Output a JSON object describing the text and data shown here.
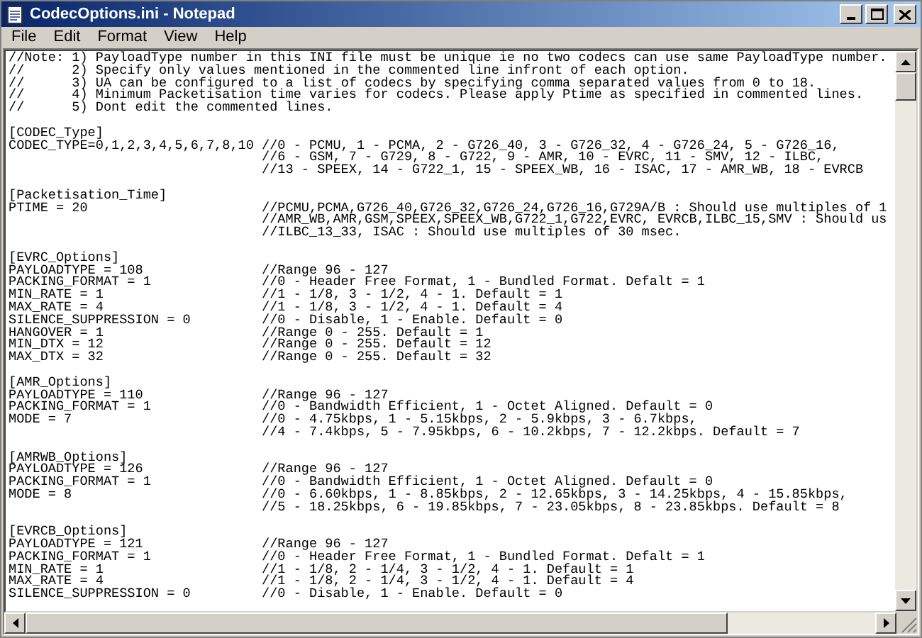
{
  "window": {
    "title": "CodecOptions.ini - Notepad"
  },
  "menu": [
    {
      "label": "File"
    },
    {
      "label": "Edit"
    },
    {
      "label": "Format"
    },
    {
      "label": "View"
    },
    {
      "label": "Help"
    }
  ],
  "blocks": [
    {
      "lines": [
        {
          "text": "//Note: 1) PayloadType number in this INI file must be unique ie no two codecs can use same PayloadType number."
        },
        {
          "text": "//      2) Specify only values mentioned in the commented line infront of each option."
        },
        {
          "text": "//      3) UA can be configured to a list of codecs by specifying comma separated values from 0 to 18."
        },
        {
          "text": "//      4) Minimum Packetisation time varies for codecs. Please apply Ptime as specified in commented lines."
        },
        {
          "text": "//      5) Dont edit the commented lines."
        }
      ]
    },
    {
      "lines": [
        {
          "text": "[CODEC_Type]"
        },
        {
          "setting": "CODEC_TYPE=0,1,2,3,4,5,6,7,8,10",
          "comment": "//0 - PCMU, 1 - PCMA, 2 - G726_40, 3 - G726_32, 4 - G726_24, 5 - G726_16,"
        },
        {
          "comment": "//6 - GSM, 7 - G729, 8 - G722, 9 - AMR, 10 - EVRC, 11 - SMV, 12 - ILBC,"
        },
        {
          "comment": "//13 - SPEEX, 14 - G722_1, 15 - SPEEX_WB, 16 - ISAC, 17 - AMR_WB, 18 - EVRCB"
        }
      ]
    },
    {
      "lines": [
        {
          "text": "[Packetisation_Time]"
        },
        {
          "setting": "PTIME = 20",
          "comment": "//PCMU,PCMA,G726_40,G726_32,G726_24,G726_16,G729A/B : Should use multiples of 1"
        },
        {
          "comment": "//AMR_WB,AMR,GSM,SPEEX,SPEEX_WB,G722_1,G722,EVRC, EVRCB,ILBC_15,SMV : Should us"
        },
        {
          "comment": "//ILBC_13_33, ISAC : Should use multiples of 30 msec."
        }
      ]
    },
    {
      "lines": [
        {
          "text": "[EVRC_Options]"
        },
        {
          "setting": "PAYLOADTYPE = 108",
          "comment": "//Range 96 - 127"
        },
        {
          "setting": "PACKING_FORMAT = 1",
          "comment": "//0 - Header Free Format, 1 - Bundled Format. Defalt = 1"
        },
        {
          "setting": "MIN_RATE = 1",
          "comment": "//1 - 1/8, 3 - 1/2, 4 - 1. Default = 1"
        },
        {
          "setting": "MAX_RATE = 4",
          "comment": "//1 - 1/8, 3 - 1/2, 4 - 1. Default = 4"
        },
        {
          "setting": "SILENCE_SUPPRESSION = 0",
          "comment": "//0 - Disable, 1 - Enable. Default = 0"
        },
        {
          "setting": "HANGOVER = 1",
          "comment": "//Range 0 - 255. Default = 1"
        },
        {
          "setting": "MIN_DTX = 12",
          "comment": "//Range 0 - 255. Default = 12"
        },
        {
          "setting": "MAX_DTX = 32",
          "comment": "//Range 0 - 255. Default = 32"
        }
      ]
    },
    {
      "lines": [
        {
          "text": "[AMR_Options]"
        },
        {
          "setting": "PAYLOADTYPE = 110",
          "comment": "//Range 96 - 127"
        },
        {
          "setting": "PACKING_FORMAT = 1",
          "comment": "//0 - Bandwidth Efficient, 1 - Octet Aligned. Default = 0"
        },
        {
          "setting": "MODE = 7",
          "comment": "//0 - 4.75kbps, 1 - 5.15kbps, 2 - 5.9kbps, 3 - 6.7kbps,"
        },
        {
          "comment": "//4 - 7.4kbps, 5 - 7.95kbps, 6 - 10.2kbps, 7 - 12.2kbps. Default = 7"
        }
      ]
    },
    {
      "lines": [
        {
          "text": "[AMRWB_Options]"
        },
        {
          "setting": "PAYLOADTYPE = 126",
          "comment": "//Range 96 - 127"
        },
        {
          "setting": "PACKING_FORMAT = 1",
          "comment": "//0 - Bandwidth Efficient, 1 - Octet Aligned. Default = 0"
        },
        {
          "setting": "MODE = 8",
          "comment": "//0 - 6.60kbps, 1 - 8.85kbps, 2 - 12.65kbps, 3 - 14.25kbps, 4 - 15.85kbps,"
        },
        {
          "comment": "//5 - 18.25kbps, 6 - 19.85kbps, 7 - 23.05kbps, 8 - 23.85kbps. Default = 8"
        }
      ]
    },
    {
      "lines": [
        {
          "text": "[EVRCB_Options]"
        },
        {
          "setting": "PAYLOADTYPE = 121",
          "comment": "//Range 96 - 127"
        },
        {
          "setting": "PACKING_FORMAT = 1",
          "comment": "//0 - Header Free Format, 1 - Bundled Format. Defalt = 1"
        },
        {
          "setting": "MIN_RATE = 1",
          "comment": "//1 - 1/8, 2 - 1/4, 3 - 1/2, 4 - 1. Default = 1"
        },
        {
          "setting": "MAX_RATE = 4",
          "comment": "//1 - 1/8, 2 - 1/4, 3 - 1/2, 4 - 1. Default = 4"
        },
        {
          "setting": "SILENCE_SUPPRESSION = 0",
          "comment": "//0 - Disable, 1 - Enable. Default = 0"
        }
      ]
    }
  ]
}
